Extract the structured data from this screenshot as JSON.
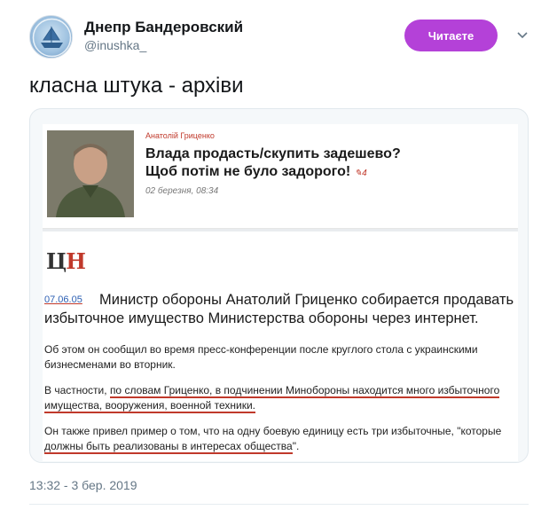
{
  "author": {
    "name": "Днепр Бандеровский",
    "handle": "@inushka_"
  },
  "follow_label": "Читаєте",
  "tweet_text": "класна штука - архіви",
  "quote": {
    "author": "Анатолій Гриценко",
    "title_line1": "Влада продасть/скупить задешево?",
    "title_line2": "Щоб потім не було задорого!",
    "count": "4",
    "date": "02 березня, 08:34"
  },
  "article": {
    "logo_left": "Ц",
    "logo_right": "Н",
    "date": "07.06.05",
    "headline": "Министр обороны Анатолий Гриценко собирается продавать избыточное имущество Министерства обороны через интернет.",
    "p1": "Об этом он сообщил во время пресс-конференции после круглого стола с украинскими бизнесменами во вторник.",
    "p2_pre": "В частности, ",
    "p2_underlined": "по словам Гриценко, в подчинении Минобороны находится много избыточного имущества, вооружения, военной техники.",
    "p3_pre": "Он также привел пример о том, что на одну боевую единицу есть три избыточные, \"которые ",
    "p3_underlined": "должны быть реализованы в интересах общества",
    "p3_post": "\"."
  },
  "timestamp": "13:32 - 3 бер. 2019",
  "colors": {
    "follow_bg": "#b441d8",
    "underline": "#c0392b",
    "handle": "#657786"
  }
}
